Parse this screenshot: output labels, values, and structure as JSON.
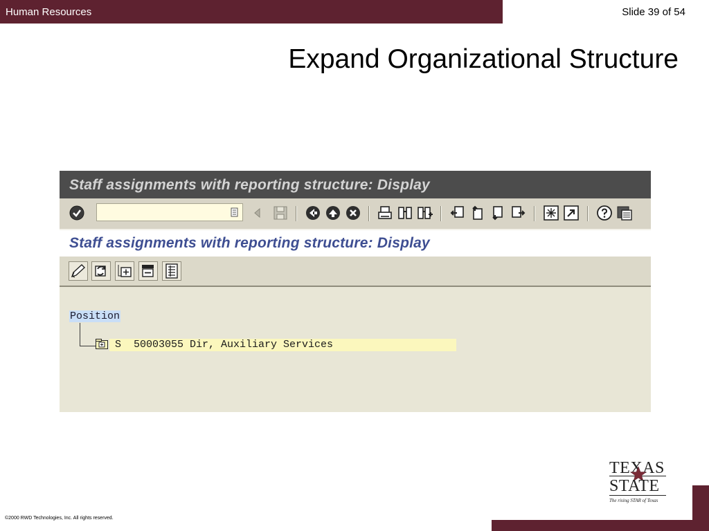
{
  "slide": {
    "section": "Human Resources",
    "slide_number": "Slide 39 of 54",
    "title": "Expand Organizational Structure",
    "copyright": "©2000 RWD Technologies, Inc.  All rights reserved."
  },
  "sap": {
    "window_title": "Staff assignments with reporting structure: Display",
    "command_field": {
      "value": "",
      "placeholder": ""
    },
    "toolbar_icons": [
      "enter-icon",
      "back-arrow-icon",
      "save-icon",
      "back-icon",
      "exit-icon",
      "cancel-icon",
      "print-icon",
      "find-icon",
      "find-next-icon",
      "first-page-icon",
      "previous-page-icon",
      "next-page-icon",
      "last-page-icon",
      "create-session-icon",
      "shortcut-icon",
      "help-icon",
      "layout-icon"
    ],
    "screen_title": "Staff assignments with reporting structure: Display",
    "app_toolbar_icons": [
      "edit-icon",
      "refresh-icon",
      "expand-subtree-icon",
      "collapse-subtree-icon",
      "details-icon"
    ],
    "tree": {
      "root_label": "Position",
      "node": {
        "type_code": "S",
        "object_id": "50003055",
        "name": "Dir, Auxiliary Services",
        "line": "S  50003055 Dir, Auxiliary Services"
      }
    }
  },
  "logo": {
    "line1": "TEXAS",
    "line2": "STATE",
    "tagline": "The rising STAR of Texas"
  },
  "colors": {
    "brand_maroon": "#5e2230",
    "sap_titlebar": "#4c4c4c",
    "sap_header_text": "#3e4e92",
    "selection_blue": "#c9def7",
    "row_highlight": "#fbf7bd"
  }
}
